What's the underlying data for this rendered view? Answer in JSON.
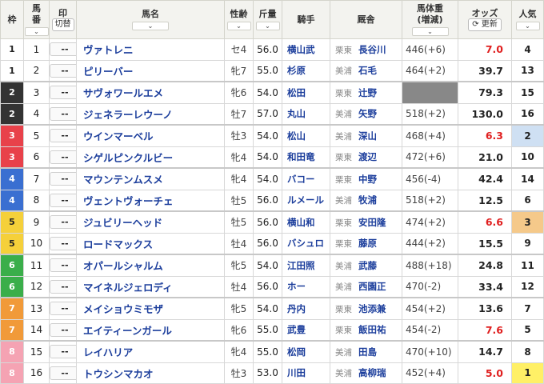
{
  "header": {
    "waku": "枠",
    "umaban": [
      "馬",
      "番"
    ],
    "mark": "印",
    "mark_toggle": "切替",
    "name": "馬名",
    "sexage": "性齢",
    "weight": "斤量",
    "jockey": "騎手",
    "stable": "厩舎",
    "body_weight": "馬体重",
    "body_weight_sub": "(増減)",
    "odds": "オッズ",
    "refresh": "更新",
    "popularity": "人気",
    "sort_glyph": "⌄"
  },
  "colors": {
    "waku1": "#ffffff",
    "waku2": "#333333",
    "waku3": "#e8414a",
    "waku4": "#3a6fd1",
    "waku5": "#f5d03a",
    "waku6": "#3aae4a",
    "waku7": "#f19a39",
    "waku8": "#f5a3b3",
    "hot_odds": "#e02020",
    "link": "#1c3e9c"
  },
  "rows": [
    {
      "waku": "1",
      "num": "1",
      "mark": "--",
      "name": "ヴァトレニ",
      "sex": "セ4",
      "weight": "56.0",
      "jockey": "横山武",
      "area": "栗東",
      "trainer": "長谷川",
      "bw": "446(+6)",
      "odds": "7.0",
      "hot": true,
      "pop": "4"
    },
    {
      "waku": "1",
      "num": "2",
      "mark": "--",
      "name": "ピリーバー",
      "sex": "牝7",
      "weight": "55.0",
      "jockey": "杉原",
      "area": "美浦",
      "trainer": "石毛",
      "bw": "464(+2)",
      "odds": "39.7",
      "hot": false,
      "pop": "13"
    },
    {
      "waku": "2",
      "num": "3",
      "mark": "--",
      "name": "サヴォワールエメ",
      "sex": "牝6",
      "weight": "54.0",
      "jockey": "松田",
      "area": "栗東",
      "trainer": "辻野",
      "bw": "",
      "odds": "79.3",
      "hot": false,
      "pop": "15"
    },
    {
      "waku": "2",
      "num": "4",
      "mark": "--",
      "name": "ジェネラーレウーノ",
      "sex": "牡7",
      "weight": "57.0",
      "jockey": "丸山",
      "area": "美浦",
      "trainer": "矢野",
      "bw": "518(+2)",
      "odds": "130.0",
      "hot": false,
      "pop": "16"
    },
    {
      "waku": "3",
      "num": "5",
      "mark": "--",
      "name": "ウインマーベル",
      "sex": "牡3",
      "weight": "54.0",
      "jockey": "松山",
      "area": "美浦",
      "trainer": "深山",
      "bw": "468(+4)",
      "odds": "6.3",
      "hot": true,
      "pop": "2"
    },
    {
      "waku": "3",
      "num": "6",
      "mark": "--",
      "name": "シゲルピンクルビー",
      "sex": "牝4",
      "weight": "54.0",
      "jockey": "和田竜",
      "area": "栗東",
      "trainer": "渡辺",
      "bw": "472(+6)",
      "odds": "21.0",
      "hot": false,
      "pop": "10"
    },
    {
      "waku": "4",
      "num": "7",
      "mark": "--",
      "name": "マウンテンムスメ",
      "sex": "牝4",
      "weight": "54.0",
      "jockey": "バコー",
      "area": "栗東",
      "trainer": "中野",
      "bw": "456(-4)",
      "odds": "42.4",
      "hot": false,
      "pop": "14"
    },
    {
      "waku": "4",
      "num": "8",
      "mark": "--",
      "name": "ヴェントヴォーチェ",
      "sex": "牡5",
      "weight": "56.0",
      "jockey": "ルメール",
      "area": "美浦",
      "trainer": "牧浦",
      "bw": "518(+2)",
      "odds": "12.5",
      "hot": false,
      "pop": "6"
    },
    {
      "waku": "5",
      "num": "9",
      "mark": "--",
      "name": "ジュビリーヘッド",
      "sex": "牡5",
      "weight": "56.0",
      "jockey": "横山和",
      "area": "栗東",
      "trainer": "安田隆",
      "bw": "474(+2)",
      "odds": "6.6",
      "hot": true,
      "pop": "3"
    },
    {
      "waku": "5",
      "num": "10",
      "mark": "--",
      "name": "ロードマックス",
      "sex": "牡4",
      "weight": "56.0",
      "jockey": "バシュロ",
      "area": "栗東",
      "trainer": "藤原",
      "bw": "444(+2)",
      "odds": "15.5",
      "hot": false,
      "pop": "9"
    },
    {
      "waku": "6",
      "num": "11",
      "mark": "--",
      "name": "オパールシャルム",
      "sex": "牝5",
      "weight": "54.0",
      "jockey": "江田照",
      "area": "美浦",
      "trainer": "武藤",
      "bw": "488(+18)",
      "odds": "24.8",
      "hot": false,
      "pop": "11"
    },
    {
      "waku": "6",
      "num": "12",
      "mark": "--",
      "name": "マイネルジェロディ",
      "sex": "牡4",
      "weight": "56.0",
      "jockey": "ホー",
      "area": "美浦",
      "trainer": "西園正",
      "bw": "470(-2)",
      "odds": "33.4",
      "hot": false,
      "pop": "12"
    },
    {
      "waku": "7",
      "num": "13",
      "mark": "--",
      "name": "メイショウミモザ",
      "sex": "牝5",
      "weight": "54.0",
      "jockey": "丹内",
      "area": "栗東",
      "trainer": "池添兼",
      "bw": "454(+2)",
      "odds": "13.6",
      "hot": false,
      "pop": "7"
    },
    {
      "waku": "7",
      "num": "14",
      "mark": "--",
      "name": "エイティーンガール",
      "sex": "牝6",
      "weight": "55.0",
      "jockey": "武豊",
      "area": "栗東",
      "trainer": "飯田祐",
      "bw": "454(-2)",
      "odds": "7.6",
      "hot": true,
      "pop": "5"
    },
    {
      "waku": "8",
      "num": "15",
      "mark": "--",
      "name": "レイハリア",
      "sex": "牝4",
      "weight": "55.0",
      "jockey": "松岡",
      "area": "美浦",
      "trainer": "田島",
      "bw": "470(+10)",
      "odds": "14.7",
      "hot": false,
      "pop": "8"
    },
    {
      "waku": "8",
      "num": "16",
      "mark": "--",
      "name": "トウシンマカオ",
      "sex": "牡3",
      "weight": "53.0",
      "jockey": "川田",
      "area": "美浦",
      "trainer": "高柳瑞",
      "bw": "452(+4)",
      "odds": "5.0",
      "hot": true,
      "pop": "1"
    }
  ]
}
